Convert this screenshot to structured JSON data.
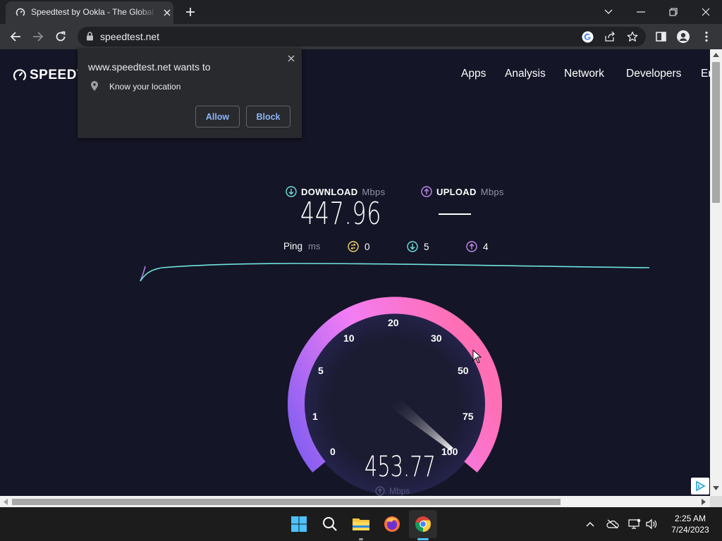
{
  "browser": {
    "tab_title": "Speedtest by Ookla - The Global Broadband Speed Test",
    "url": "speedtest.net"
  },
  "permission_popup": {
    "title": "www.speedtest.net wants to",
    "request": "Know your location",
    "allow_label": "Allow",
    "block_label": "Block"
  },
  "site": {
    "logo_text": "SPEEDT",
    "nav": [
      "Apps",
      "Analysis",
      "Network",
      "Developers",
      "Er"
    ]
  },
  "results": {
    "download_label": "DOWNLOAD",
    "download_unit": "Mbps",
    "download_value": "447.96",
    "upload_label": "UPLOAD",
    "upload_unit": "Mbps",
    "ping_label": "Ping",
    "ping_unit": "ms",
    "ping_idle": "0",
    "ping_download": "5",
    "ping_upload": "4"
  },
  "gauge": {
    "ticks": [
      "0",
      "1",
      "5",
      "10",
      "20",
      "30",
      "50",
      "75",
      "100"
    ],
    "value": "453.77",
    "unit": "Mbps"
  },
  "taskbar": {
    "time": "2:25 AM",
    "date": "7/24/2023"
  },
  "colors": {
    "accent_download": "#6fe3de",
    "accent_upload": "#c18cf0",
    "gauge_start": "#7d5cf0",
    "gauge_end": "#ff6fb5",
    "link_blue": "#8ab4f8"
  }
}
